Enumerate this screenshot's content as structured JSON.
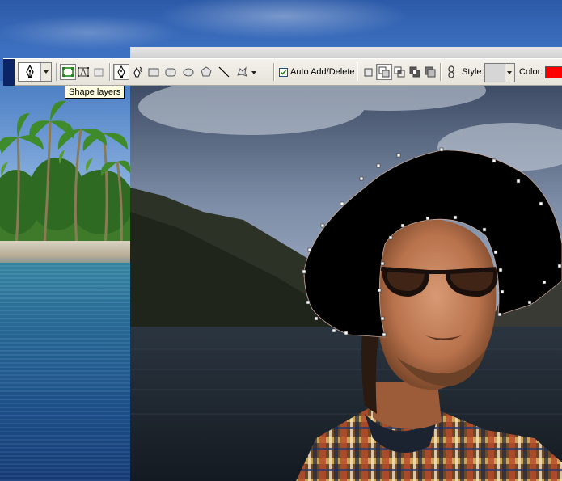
{
  "options_bar": {
    "auto_add_delete_label": "Auto Add/Delete",
    "auto_add_delete_checked": true,
    "style_label": "Style:",
    "color_label": "Color:",
    "layer_color": "#ff0000"
  },
  "tooltip": {
    "text": "Shape layers"
  },
  "icons": {
    "tool_preset": "pen-tool-icon",
    "shape_layers": "shape-layers-icon",
    "paths": "paths-icon",
    "fill_pixels": "fill-pixels-icon",
    "pen": "pen-icon",
    "freeform_pen": "freeform-pen-icon",
    "rectangle": "rectangle-icon",
    "rounded_rectangle": "rounded-rectangle-icon",
    "ellipse": "ellipse-icon",
    "polygon": "polygon-icon",
    "line": "line-icon",
    "custom_shape": "custom-shape-icon",
    "link": "link-icon"
  }
}
